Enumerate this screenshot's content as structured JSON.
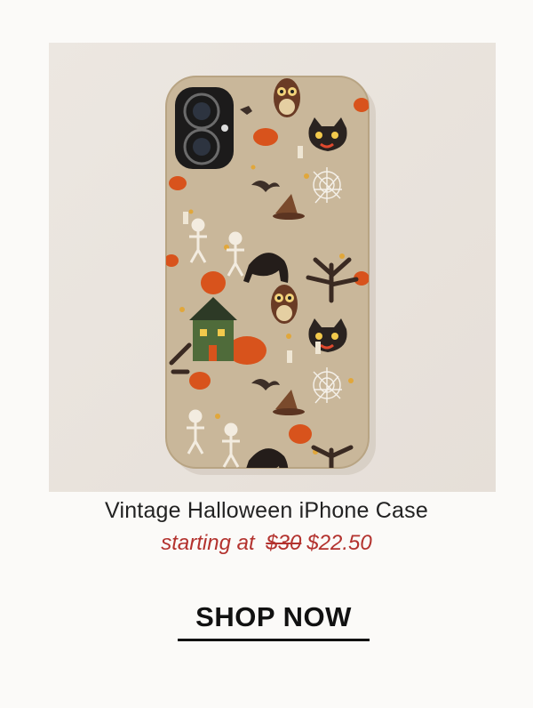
{
  "product": {
    "title": "Vintage Halloween iPhone Case",
    "price_prefix": "starting at",
    "original_price": "$30",
    "sale_price": "$22.50",
    "image_alt": "Vintage Halloween patterned phone case"
  },
  "cta": {
    "label": "SHOP NOW"
  },
  "colors": {
    "background": "#fbfaf8",
    "sale_price": "#b3322e",
    "case_base": "#c9b79a",
    "cta_text": "#111111"
  },
  "icons": [
    "owl-icon",
    "black-cat-icon",
    "bat-icon",
    "witch-hat-icon",
    "spider-web-icon",
    "pumpkin-icon",
    "skeleton-icon",
    "moon-icon",
    "haunted-house-icon",
    "tree-icon"
  ]
}
